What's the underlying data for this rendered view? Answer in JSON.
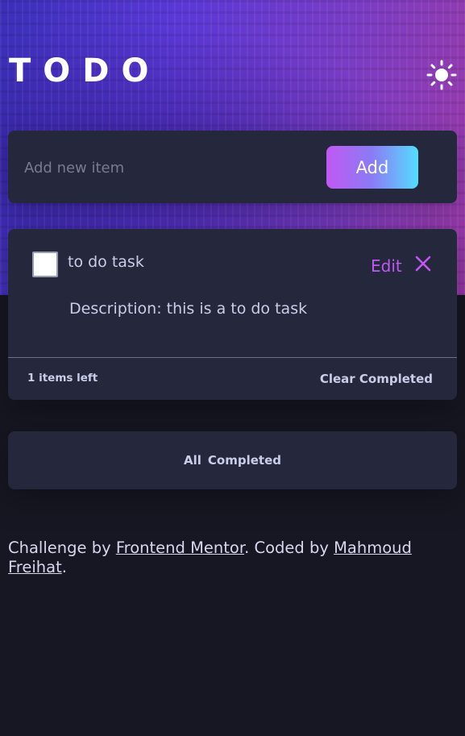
{
  "header": {
    "title": "TODO",
    "theme_toggle_icon": "sun-icon"
  },
  "new_item": {
    "placeholder": "Add new item",
    "value": "",
    "add_label": "Add"
  },
  "todos": [
    {
      "title": "to do task",
      "description": "Description: this is a to do task",
      "completed": false,
      "edit_label": "Edit",
      "delete_icon": "close-icon"
    }
  ],
  "footer": {
    "items_left": "1 items left",
    "clear_label": "Clear Completed"
  },
  "filters": {
    "all": "All",
    "completed": "Completed"
  },
  "attribution": {
    "prefix": "Challenge by ",
    "mentor_link": "Frontend Mentor",
    "middle": ". Coded by ",
    "author_link": "Mahmoud Freihat",
    "suffix": "."
  },
  "colors": {
    "background": "#161722",
    "card": "#25273c",
    "accent_purple": "#c058f3",
    "accent_cyan": "#55ddff",
    "text": "#cacde8"
  }
}
